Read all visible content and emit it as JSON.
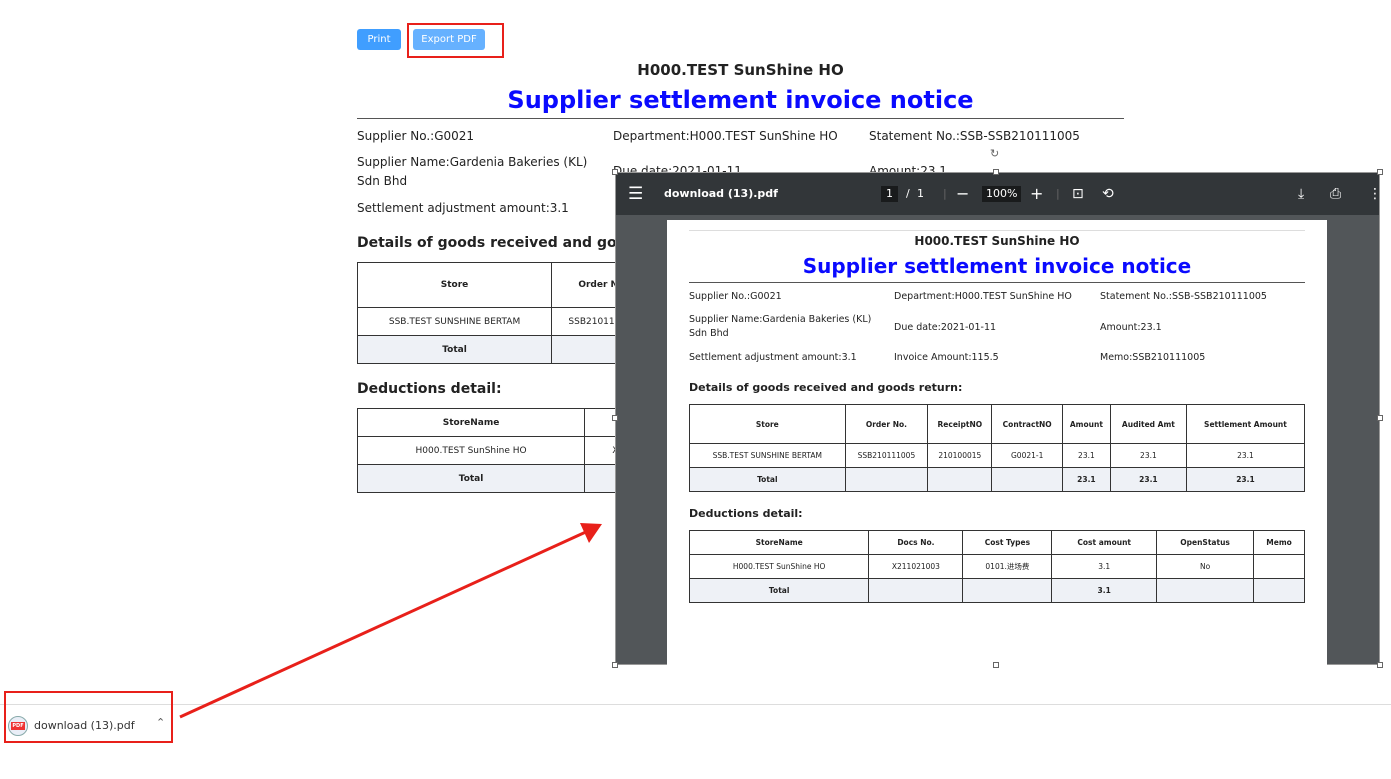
{
  "toolbar": {
    "print": "Print",
    "export": "Export PDF"
  },
  "doc": {
    "company": "H000.TEST SunShine HO",
    "title": "Supplier settlement invoice notice",
    "supplier_no": "Supplier No.:G0021",
    "department": "Department:H000.TEST SunShine HO",
    "statement_no": "Statement No.:SSB-SSB210111005",
    "supplier_name": "Supplier Name:Gardenia Bakeries (KL) Sdn Bhd",
    "due_date": "Due date:2021-01-11",
    "amount": "Amount:23.1",
    "adjustment": "Settlement adjustment amount:3.1",
    "invoice_amount": "Invoice Amount:115.5",
    "memo": "Memo:SSB210111005",
    "goods_heading": "Details of goods received and goods return:",
    "goods_heading_bg": "Details of goods received and goods",
    "goods_table": {
      "headers": [
        "Store",
        "Order No.",
        "ReceiptNO",
        "ContractNO",
        "Amount",
        "Audited Amt",
        "Settlement Amount"
      ],
      "rows": [
        [
          "SSB.TEST SUNSHINE BERTAM",
          "SSB210111005",
          "210100015",
          "G0021-1",
          "23.1",
          "23.1",
          "23.1"
        ]
      ],
      "total": [
        "Total",
        "",
        "",
        "",
        "23.1",
        "23.1",
        "23.1"
      ]
    },
    "deductions_heading": "Deductions detail:",
    "deductions_table": {
      "headers": [
        "StoreName",
        "Docs No.",
        "Cost Types",
        "Cost amount",
        "OpenStatus",
        "Memo"
      ],
      "rows": [
        [
          "H000.TEST SunShine HO",
          "X211021003",
          "0101.进场费",
          "3.1",
          "No",
          ""
        ]
      ],
      "total": [
        "Total",
        "",
        "",
        "3.1",
        "",
        ""
      ]
    },
    "bg_docs_no": "X21102100"
  },
  "viewer": {
    "filename": "download (13).pdf",
    "page": "1",
    "pages": "1",
    "zoom": "100%"
  },
  "download": {
    "filename": "download (13).pdf",
    "icon_label": "PDF"
  },
  "colors": {
    "accent": "#409eff",
    "title": "#0a0aff",
    "annotation": "#e8201a"
  }
}
